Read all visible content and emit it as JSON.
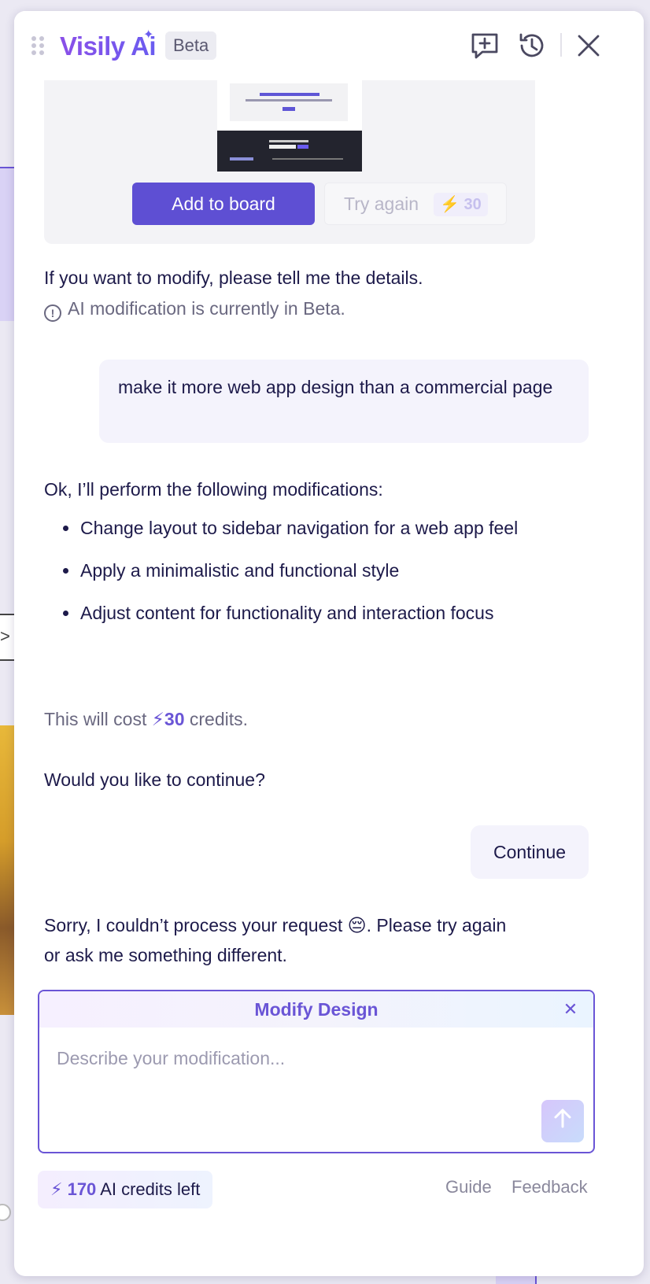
{
  "header": {
    "logo_text": "Visily Ai",
    "beta_label": "Beta",
    "icons": [
      "new-chat-icon",
      "history-icon",
      "close-icon"
    ]
  },
  "preview": {
    "add_button": "Add to board",
    "try_again_button": "Try again",
    "try_again_cost": "30"
  },
  "chat": {
    "assistant_1": "If you want to modify, please tell me the details.",
    "beta_note": "AI modification is currently in Beta.",
    "user_1": "make it more web app design than a commercial page",
    "assistant_2_intro": "Ok, I’ll perform the following modifications:",
    "modifications": [
      "Change layout to sidebar navigation for a web app feel",
      "Apply a minimalistic and functional style",
      "Adjust content for functionality and interaction focus"
    ],
    "cost_prefix": "This will cost",
    "cost_value": "30",
    "cost_suffix": "credits.",
    "continue_question": "Would you like to continue?",
    "continue_reply": "Continue",
    "error_message": "Sorry, I couldn’t process your request 😔. Please try again or ask me something different."
  },
  "modify": {
    "title": "Modify Design",
    "placeholder": "Describe your modification..."
  },
  "footer": {
    "credits_value": "170",
    "credits_label": "AI credits left",
    "guide_link": "Guide",
    "feedback_link": "Feedback"
  },
  "colors": {
    "accent": "#6a55d6",
    "primary_button": "#5e4fd3",
    "bubble": "#f4f3fc"
  }
}
